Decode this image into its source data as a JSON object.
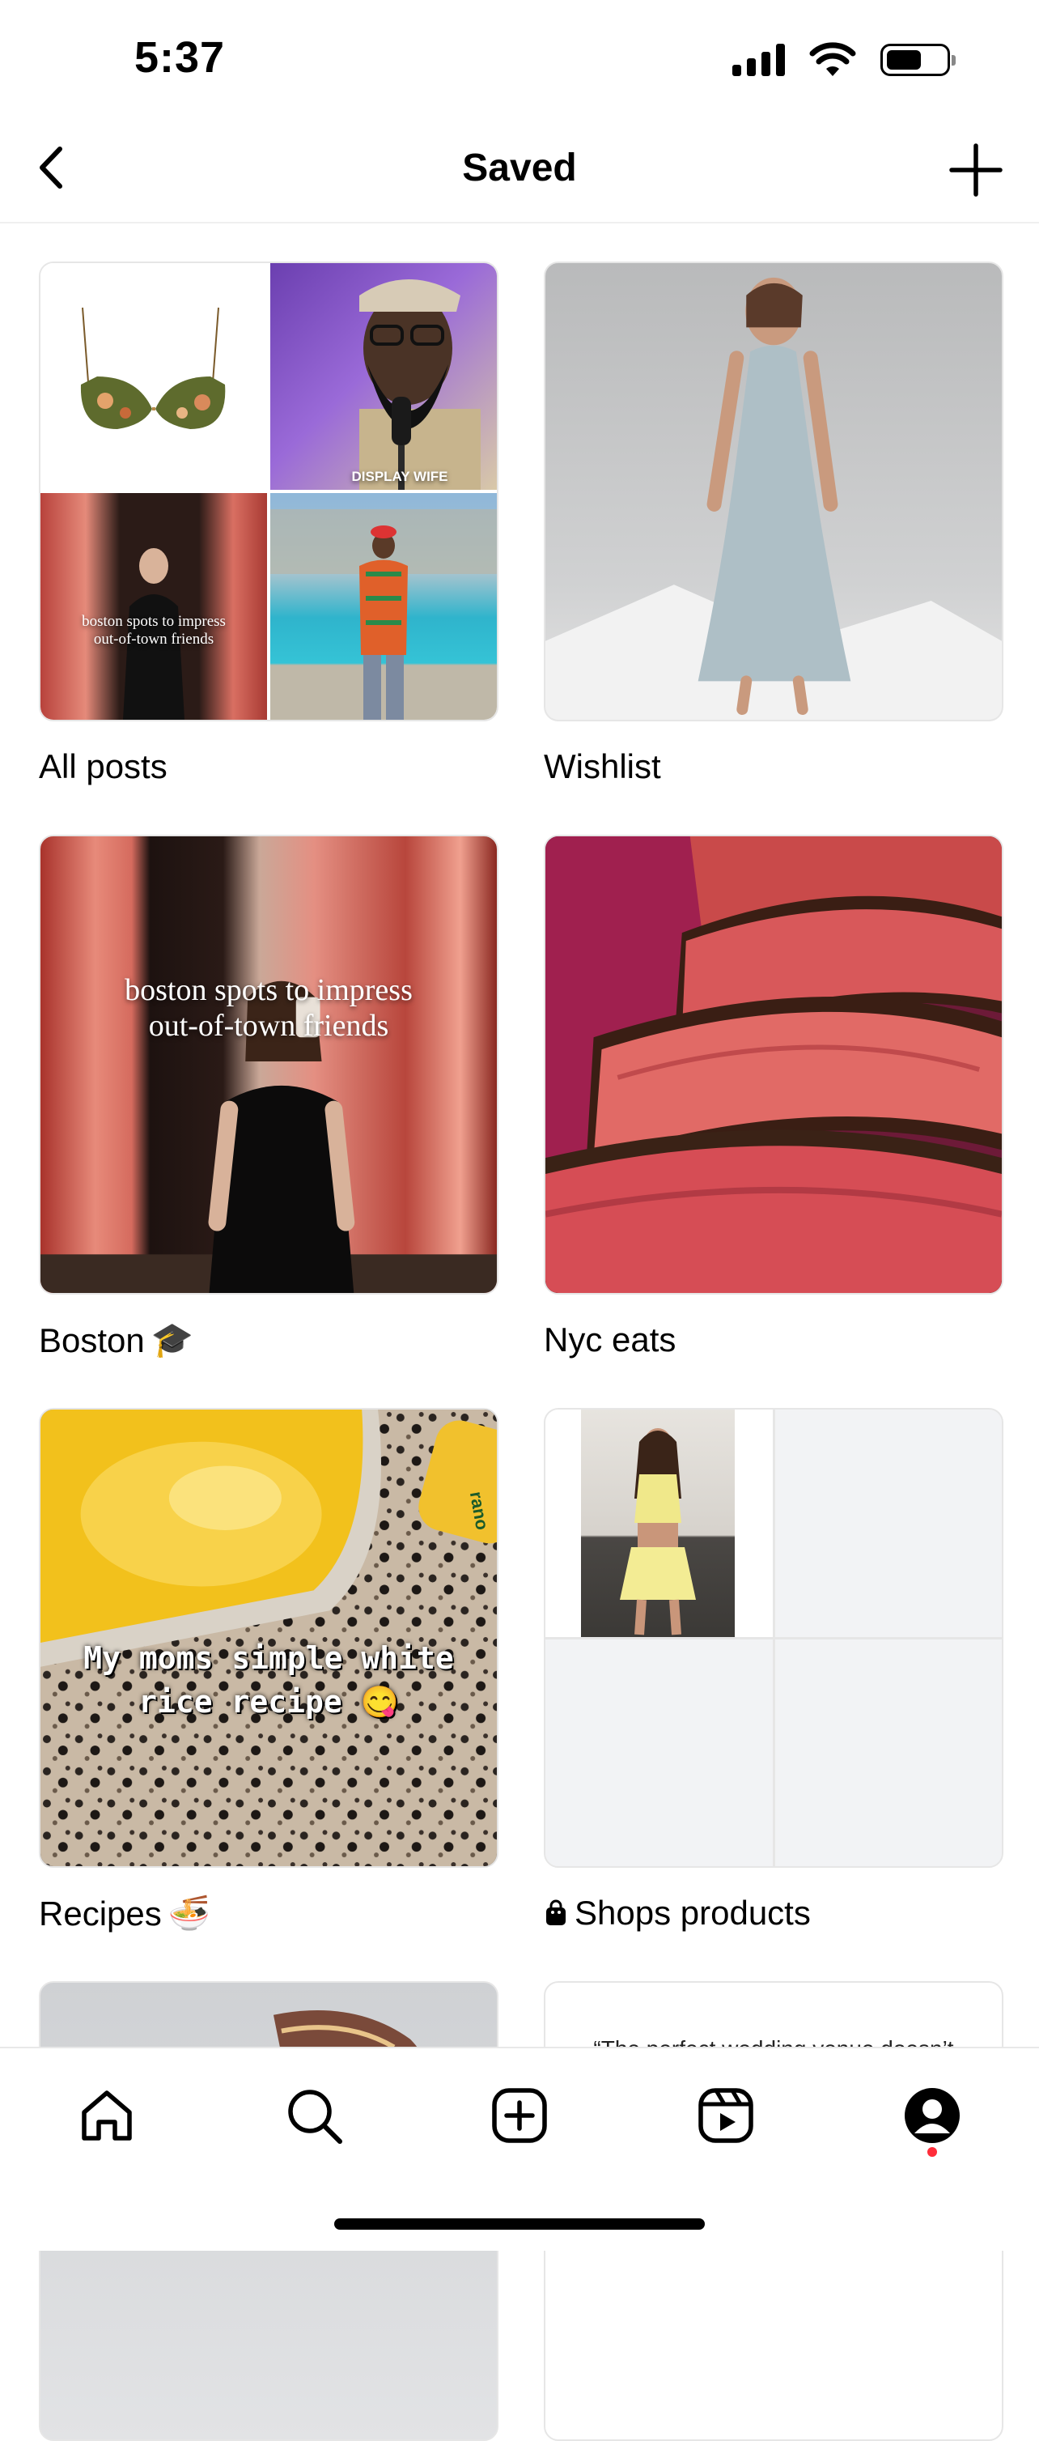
{
  "status_bar": {
    "time": "5:37",
    "signal_bars": 4,
    "battery_level": 0.6
  },
  "header": {
    "title": "Saved",
    "back_icon": "chevron-left-icon",
    "add_icon": "plus-icon"
  },
  "collections": [
    {
      "label": "All posts",
      "quad_overlays": {
        "display_wife": "DISPLAY WIFE",
        "boston_line1": "boston spots to impress",
        "boston_line2": "out-of-town friends"
      }
    },
    {
      "label": "Wishlist"
    },
    {
      "label": "Boston",
      "emoji": "🎓",
      "overlay_line1": "boston spots to impress",
      "overlay_line2": "out-of-town friends"
    },
    {
      "label": "Nyc eats"
    },
    {
      "label": "Recipes",
      "emoji": "🍜",
      "overlay_line1": "My moms simple white",
      "overlay_line2": "rice recipe 😋",
      "can_label": "rano"
    },
    {
      "label": "Shops products",
      "icon": "shopping-bag-icon"
    },
    {
      "label": "",
      "overlay": ""
    },
    {
      "label": "",
      "overlay": "“The perfect wedding venue doesn’t"
    }
  ],
  "tab_bar": {
    "tabs": [
      "home-icon",
      "search-icon",
      "create-icon",
      "reels-icon",
      "profile-icon"
    ],
    "active": "profile-icon",
    "notification_color": "#ff2d3a"
  }
}
